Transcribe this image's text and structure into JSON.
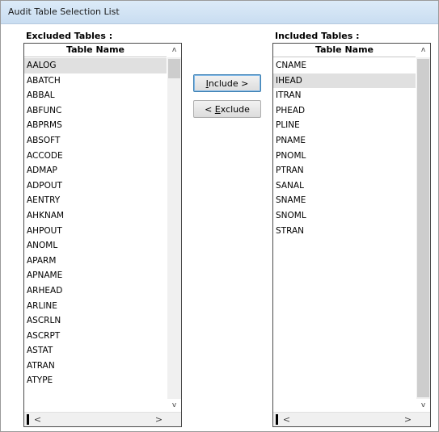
{
  "window": {
    "title": "Audit Table Selection List"
  },
  "excluded": {
    "label": "Excluded Tables :",
    "column_header": "Table Name",
    "items": [
      "AALOG",
      "ABATCH",
      "ABBAL",
      "ABFUNC",
      "ABPRMS",
      "ABSOFT",
      "ACCODE",
      "ADMAP",
      "ADPOUT",
      "AENTRY",
      "AHKNAM",
      "AHPOUT",
      "ANOML",
      "APARM",
      "APNAME",
      "ARHEAD",
      "ARLINE",
      "ASCRLN",
      "ASCRPT",
      "ASTAT",
      "ATRAN",
      "ATYPE"
    ],
    "selected": "AALOG"
  },
  "included": {
    "label": "Included Tables :",
    "column_header": "Table Name",
    "items": [
      "CNAME",
      "IHEAD",
      "ITRAN",
      "PHEAD",
      "PLINE",
      "PNAME",
      "PNOML",
      "PTRAN",
      "SANAL",
      "SNAME",
      "SNOML",
      "STRAN"
    ],
    "selected": "IHEAD"
  },
  "buttons": {
    "include": {
      "label": "Include >",
      "mnemonic": "I"
    },
    "exclude": {
      "label": "< Exclude",
      "mnemonic": "E"
    }
  },
  "icons": {
    "scroll_up": "ʌ",
    "scroll_down": "v",
    "scroll_left": "<",
    "scroll_right": ">"
  },
  "colors": {
    "titlebar": "#c9ddf1",
    "selection": "#e0e0e0",
    "default_button_border": "#3c7fb1"
  }
}
